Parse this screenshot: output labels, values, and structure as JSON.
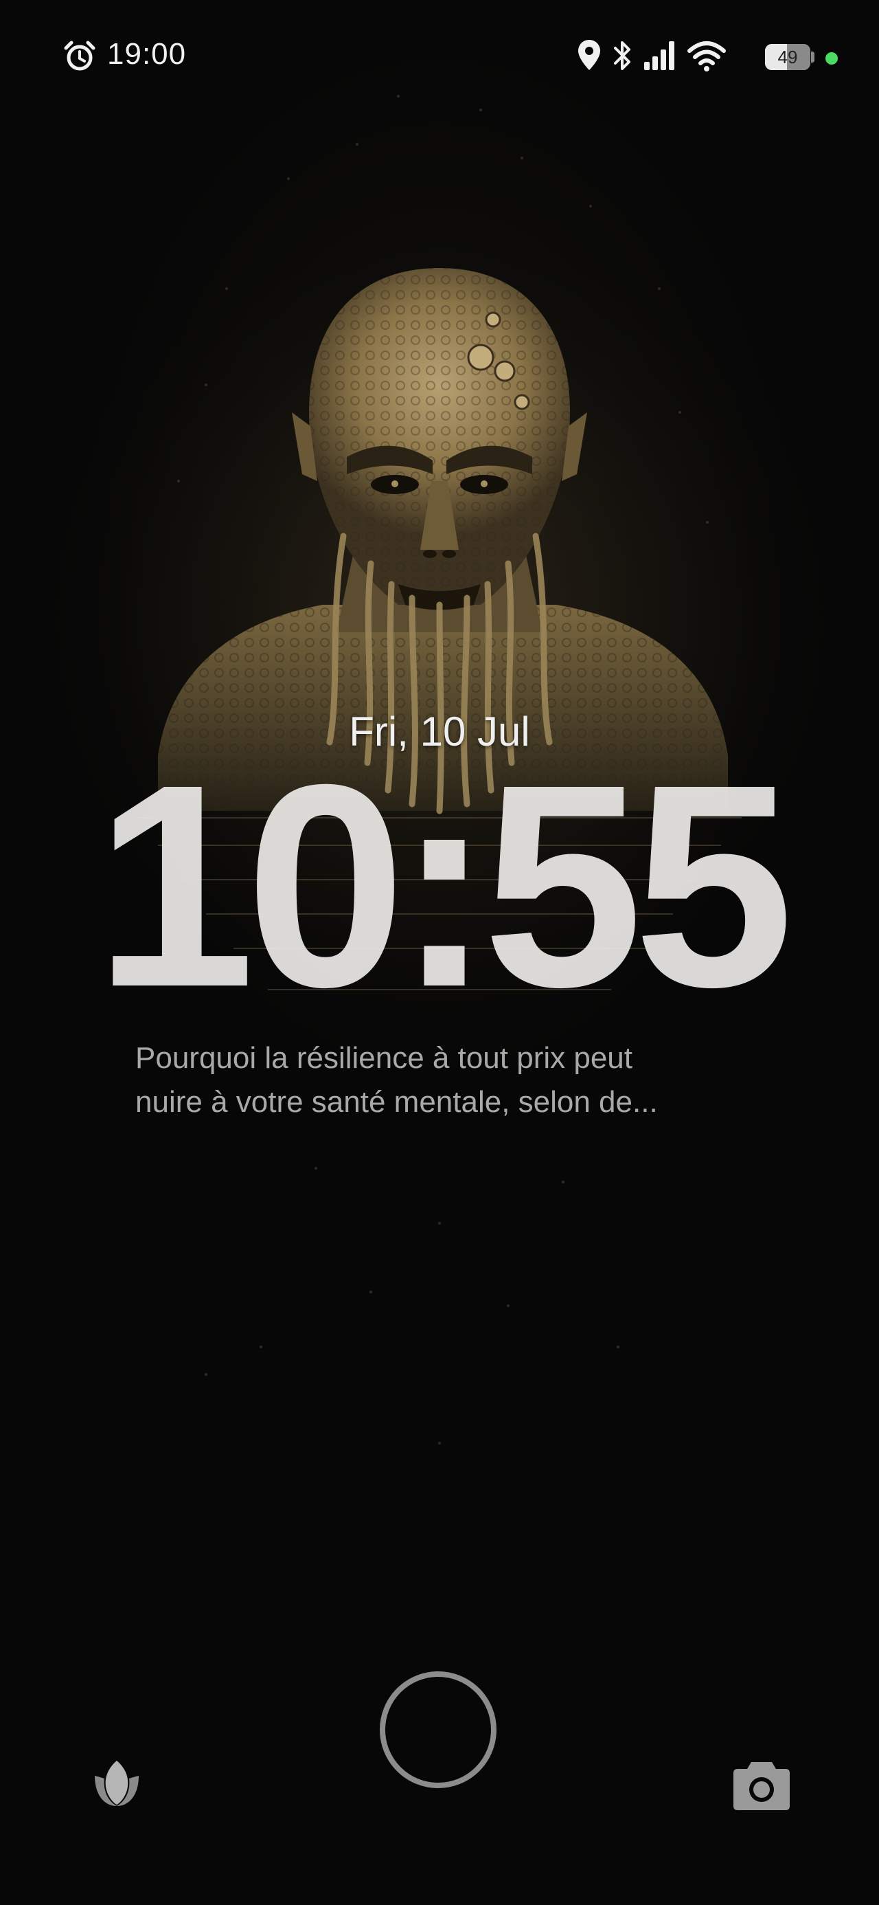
{
  "status_bar": {
    "time": "19:00",
    "battery_percent": "49",
    "battery_level": 0.49,
    "icons": [
      "alarm-icon",
      "location-icon",
      "bluetooth-icon",
      "signal-icon",
      "wifi-icon",
      "battery-icon"
    ],
    "privacy_dot_color": "#4cd964"
  },
  "lock_screen": {
    "date": "Fri, 10 Jul",
    "clock": "10:55",
    "notification_line1": "Pourquoi la résilience à tout prix peut",
    "notification_line2": "nuire à votre santé mentale, selon de..."
  },
  "bottom_bar": {
    "left_shortcut_icon": "flower-icon",
    "right_shortcut_icon": "camera-icon"
  },
  "colors": {
    "background": "#070707",
    "wallpaper_tone": "#a48f63",
    "clock": "#e8e6e3",
    "notification_text": "#a9a9a9"
  }
}
